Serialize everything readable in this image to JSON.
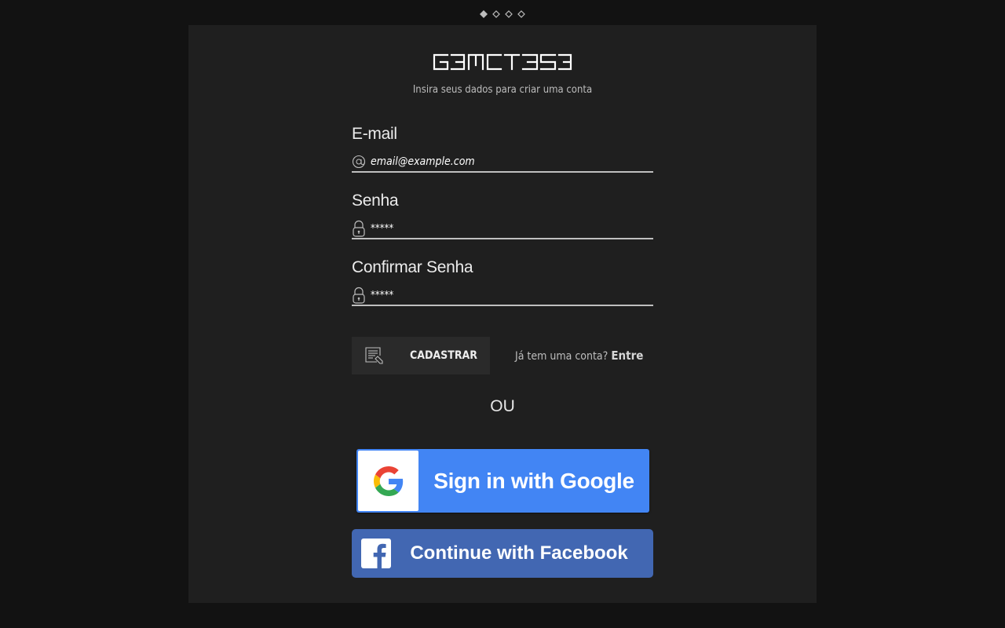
{
  "pager": {
    "count": 4,
    "active_index": 0
  },
  "brand": {
    "logo_text": "GAMETASE"
  },
  "header": {
    "subtitle": "Insira seus dados para criar uma conta"
  },
  "form": {
    "email": {
      "label": "E-mail",
      "value": "email@example.com",
      "icon": "at-icon"
    },
    "password": {
      "label": "Senha",
      "value": "*****",
      "icon": "lock-icon"
    },
    "confirm_password": {
      "label": "Confirmar Senha",
      "value": "*****",
      "icon": "lock-icon"
    }
  },
  "actions": {
    "register_label": "CADASTRAR",
    "register_icon": "document-edit-icon",
    "login_prompt": "Já tem uma conta?",
    "login_link": "Entre"
  },
  "separator": {
    "label": "OU"
  },
  "social": {
    "google_label": "Sign in with Google",
    "facebook_label": "Continue with Facebook"
  },
  "colors": {
    "page_bg": "#121212",
    "card_bg": "#1f1f1f",
    "button_bg": "#2a2a2a",
    "google_blue": "#4285f4",
    "facebook_blue": "#4267b2"
  }
}
